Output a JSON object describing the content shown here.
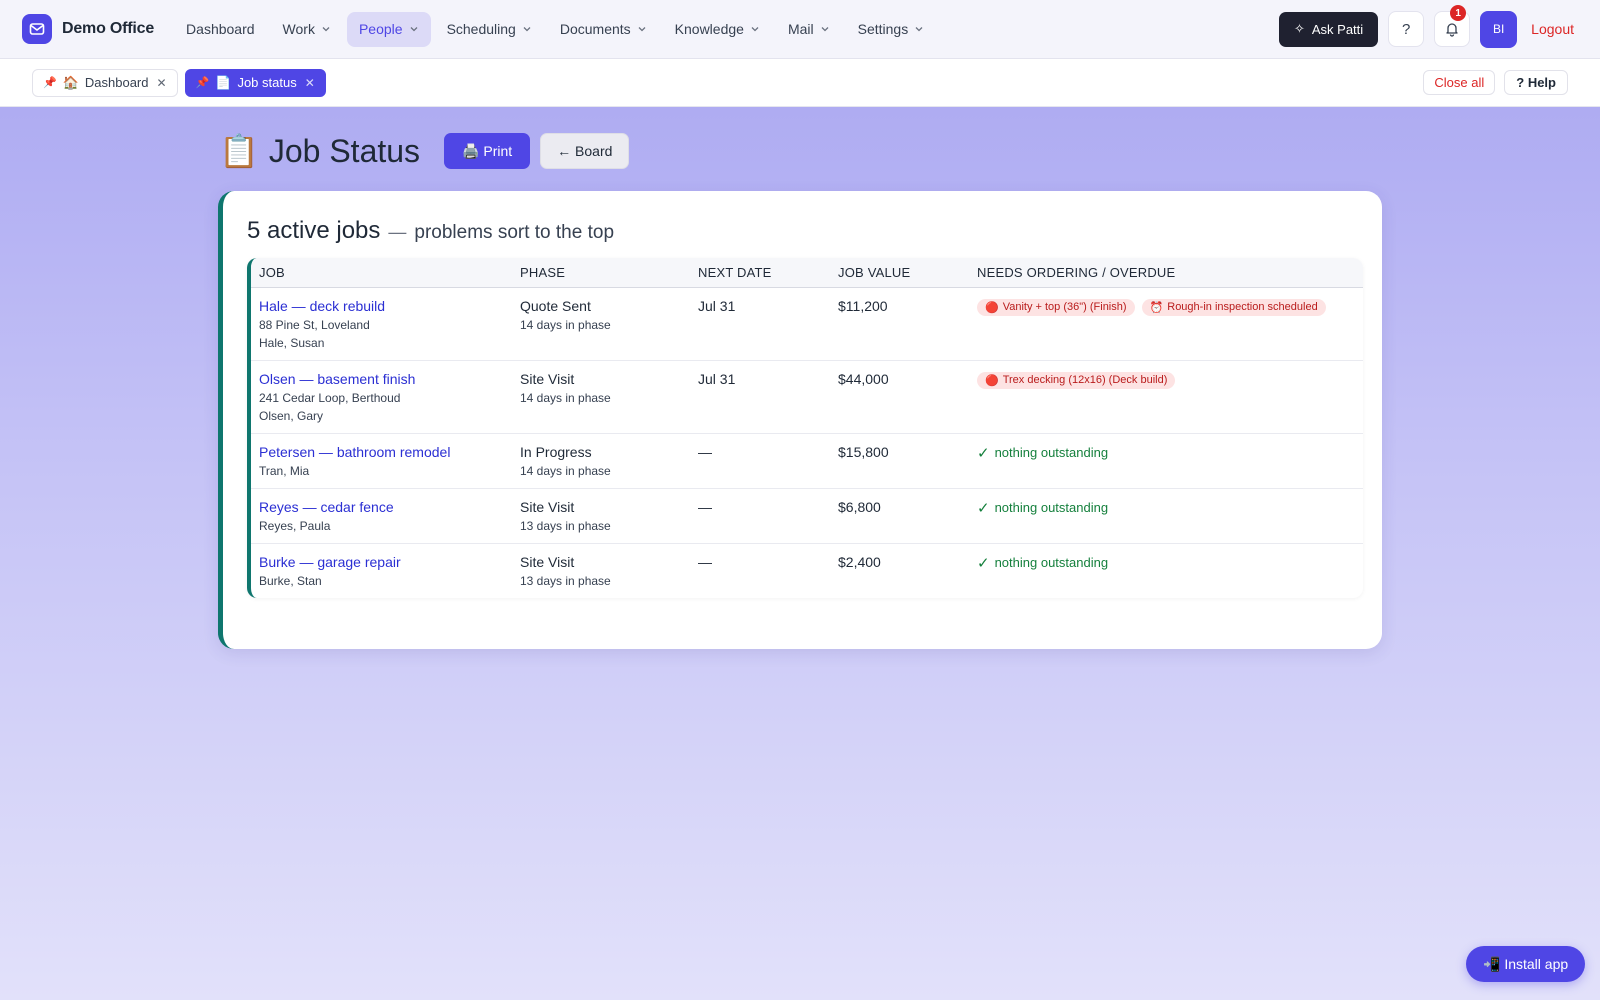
{
  "nav": {
    "brand": "Demo Office",
    "items": [
      {
        "label": "Dashboard",
        "dropdown": false
      },
      {
        "label": "Work",
        "dropdown": true
      },
      {
        "label": "People",
        "dropdown": true,
        "active": true
      },
      {
        "label": "Scheduling",
        "dropdown": true
      },
      {
        "label": "Documents",
        "dropdown": true
      },
      {
        "label": "Knowledge",
        "dropdown": true
      },
      {
        "label": "Mail",
        "dropdown": true
      },
      {
        "label": "Settings",
        "dropdown": true
      }
    ],
    "ask_label": "Ask Patti",
    "help_label": "?",
    "notification_count": "1",
    "avatar_initials": "BI",
    "logout_label": "Logout"
  },
  "tabs": {
    "items": [
      {
        "pin": "📌",
        "icon": "🏠",
        "label": "Dashboard",
        "active": false
      },
      {
        "pin": "📌",
        "icon": "📄",
        "label": "Job status",
        "active": true
      }
    ],
    "close_all_label": "Close all",
    "help_label": "? Help"
  },
  "page": {
    "title_icon": "📋",
    "title": "Job Status",
    "print_label": "🖨️ Print",
    "board_label": "← Board"
  },
  "summary": {
    "count_text": "5 active jobs",
    "separator": "—",
    "subtitle": "problems sort to the top"
  },
  "table": {
    "headers": [
      "JOB",
      "PHASE",
      "NEXT DATE",
      "JOB VALUE",
      "NEEDS ORDERING / OVERDUE"
    ],
    "rows": [
      {
        "job": "Hale — deck rebuild",
        "details": [
          "88 Pine St, Loveland",
          "Hale, Susan"
        ],
        "phase": "Quote Sent",
        "phase_days": "14 days in phase",
        "next_date": "Jul 31",
        "value": "$11,200",
        "issues": [
          {
            "icon": "🔴",
            "text": "Vanity + top (36\") (Finish)"
          },
          {
            "icon": "⏰",
            "text": "Rough-in inspection scheduled"
          }
        ],
        "ok_text": ""
      },
      {
        "job": "Olsen — basement finish",
        "details": [
          "241 Cedar Loop, Berthoud",
          "Olsen, Gary"
        ],
        "phase": "Site Visit",
        "phase_days": "14 days in phase",
        "next_date": "Jul 31",
        "value": "$44,000",
        "issues": [
          {
            "icon": "🔴",
            "text": "Trex decking (12x16) (Deck build)"
          }
        ],
        "ok_text": ""
      },
      {
        "job": "Petersen — bathroom remodel",
        "details": [
          "Tran, Mia"
        ],
        "phase": "In Progress",
        "phase_days": "14 days in phase",
        "next_date": "—",
        "value": "$15,800",
        "issues": [],
        "ok_text": "nothing outstanding"
      },
      {
        "job": "Reyes — cedar fence",
        "details": [
          "Reyes, Paula"
        ],
        "phase": "Site Visit",
        "phase_days": "13 days in phase",
        "next_date": "—",
        "value": "$6,800",
        "issues": [],
        "ok_text": "nothing outstanding"
      },
      {
        "job": "Burke — garage repair",
        "details": [
          "Burke, Stan"
        ],
        "phase": "Site Visit",
        "phase_days": "13 days in phase",
        "next_date": "—",
        "value": "$2,400",
        "issues": [],
        "ok_text": "nothing outstanding"
      }
    ]
  },
  "ok_mark": "✓",
  "install_label": "📲 Install app",
  "colors": {
    "accent": "#4f46e5",
    "card_border": "#0f766e",
    "danger": "#dc2626",
    "success": "#15803d"
  }
}
